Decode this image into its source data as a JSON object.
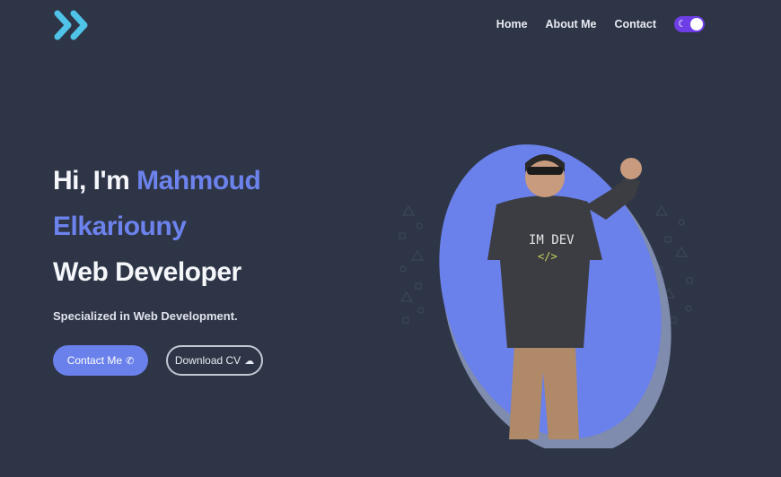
{
  "nav": {
    "items": [
      {
        "label": "Home"
      },
      {
        "label": "About Me"
      },
      {
        "label": "Contact"
      }
    ],
    "toggle_icon": "moon-icon"
  },
  "hero": {
    "greeting": "Hi, I'm ",
    "name_line1": "Mahmoud",
    "name_line2": "Elkariouny",
    "role": "Web Developer",
    "subtitle": "Specialized in Web Development.",
    "contact_label": "Contact Me",
    "contact_icon": "phone-icon",
    "cv_label": "Download CV",
    "cv_icon": "download-cloud-icon"
  },
  "colors": {
    "background": "#2e3546",
    "accent": "#6c82ec",
    "logo": "#4fc3e8",
    "toggle": "#6d3ee6"
  }
}
